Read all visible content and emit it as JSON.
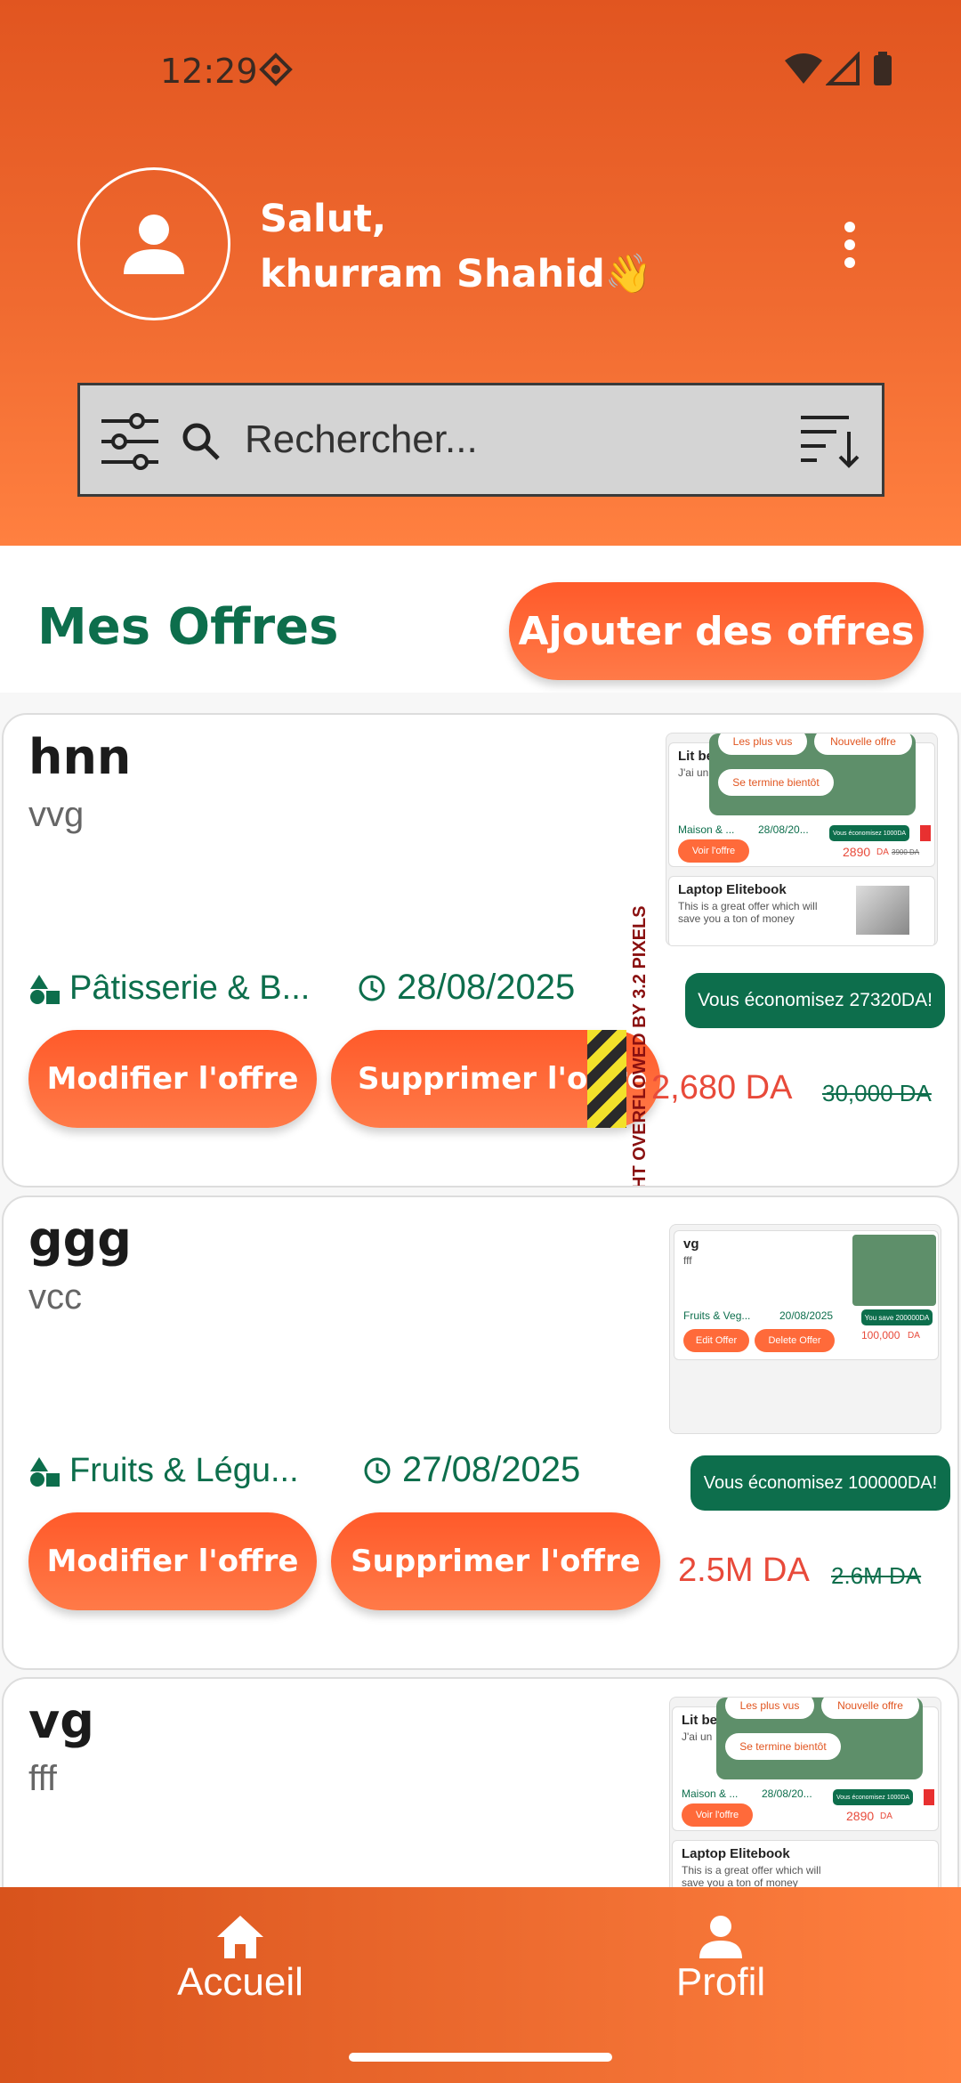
{
  "status": {
    "time": "12:29"
  },
  "header": {
    "greeting": "Salut,",
    "username": "khurram Shahid👋"
  },
  "search": {
    "placeholder": "Rechercher..."
  },
  "section": {
    "title": "Mes Offres",
    "add_button": "Ajouter des offres"
  },
  "offers": [
    {
      "title": "hnn",
      "subtitle": "vvg",
      "category": "Pâtisserie & B...",
      "date": "28/08/2025",
      "saving": "Vous économisez 27320DA!",
      "price": "2,680 DA",
      "old_price": "30,000 DA",
      "edit_label": "Modifier l'offre",
      "delete_label": "Supprimer l'offre"
    },
    {
      "title": "ggg",
      "subtitle": "vcc",
      "category": "Fruits & Légu...",
      "date": "27/08/2025",
      "saving": "Vous économisez 100000DA!",
      "price": "2.5M DA",
      "old_price": "2.6M DA",
      "edit_label": "Modifier l'offre",
      "delete_label": "Supprimer l'offre"
    },
    {
      "title": "vg",
      "subtitle": "fff"
    }
  ],
  "overflow_warning": "HT OVERFLOWED BY 3.2 PIXELS",
  "thumbs": {
    "lit": "Lit be",
    "lit_desc": "J'ai un",
    "chips": [
      "Les plus vus",
      "Nouvelle offre",
      "Se termine bientôt"
    ],
    "maison": "Maison & ...",
    "maison_date": "28/08/20...",
    "voir": "Voir l'offre",
    "saving_small": "Vous économisez 1000DA",
    "price_small": "2890",
    "price_small_unit": "DA",
    "price_small_old": "3900 DA",
    "laptop": "Laptop Elitebook",
    "laptop_desc": "This is a great offer which will save you a ton of money",
    "vg": "vg",
    "fff": "fff",
    "fruits": "Fruits & Veg...",
    "fruits_date": "20/08/2025",
    "you_save": "You save 200000DA",
    "edit_offer": "Edit Offer",
    "delete_offer": "Delete Offer",
    "price_100k": "100,000",
    "price_100k_unit": "DA"
  },
  "nav": {
    "home": "Accueil",
    "profile": "Profil"
  },
  "colors": {
    "accent": "#ff5a2a",
    "green": "#0d6e4c",
    "price_red": "#e84a3a"
  }
}
